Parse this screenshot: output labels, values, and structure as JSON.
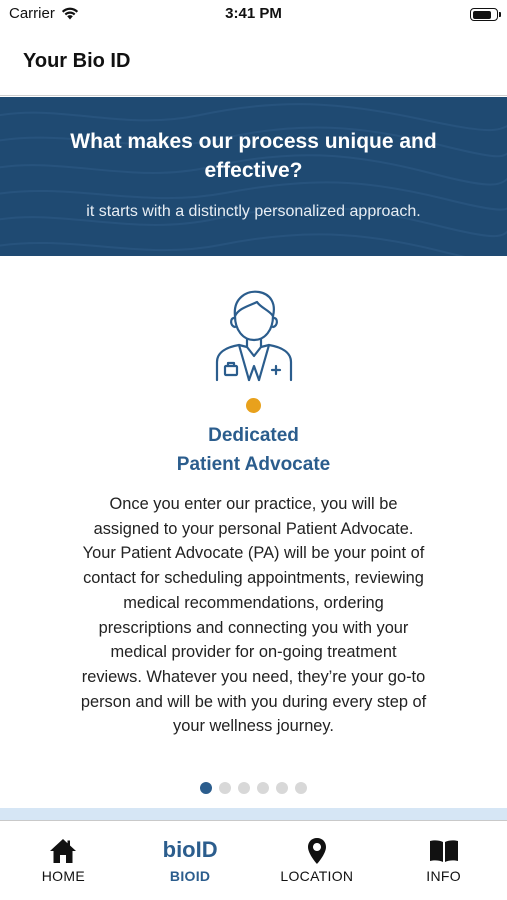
{
  "status_bar": {
    "carrier": "Carrier",
    "time": "3:41 PM",
    "battery_level": 0.85
  },
  "nav": {
    "title": "Your Bio ID"
  },
  "banner": {
    "title_line1": "What makes our process unique and",
    "title_line2": "effective?",
    "subtitle": "it starts with a distinctly personalized approach."
  },
  "card": {
    "icon": "doctor-icon",
    "title_line1": "Dedicated",
    "title_line2": "Patient Advocate",
    "body_lines": [
      "Once you enter our practice, you will be",
      "assigned to your personal Patient Advocate.",
      "Your Patient Advocate (PA) will be your point of",
      "contact for scheduling appointments, reviewing",
      "medical recommendations, ordering",
      "prescriptions and connecting you with your",
      "medical provider for on-going treatment",
      "reviews. Whatever you need, they’re your go-to",
      "person and will be with you during every step of",
      "your wellness journey."
    ]
  },
  "pager": {
    "total": 6,
    "active_index": 0
  },
  "tabs": [
    {
      "label": "HOME",
      "icon": "home-icon"
    },
    {
      "label": "BIOID",
      "logo": "bioID",
      "active": true
    },
    {
      "label": "LOCATION",
      "icon": "location-pin-icon"
    },
    {
      "label": "INFO",
      "icon": "book-icon"
    }
  ],
  "colors": {
    "banner_bg": "#1f4a72",
    "accent_blue": "#2b5d8d",
    "accent_orange": "#e8a11c"
  }
}
